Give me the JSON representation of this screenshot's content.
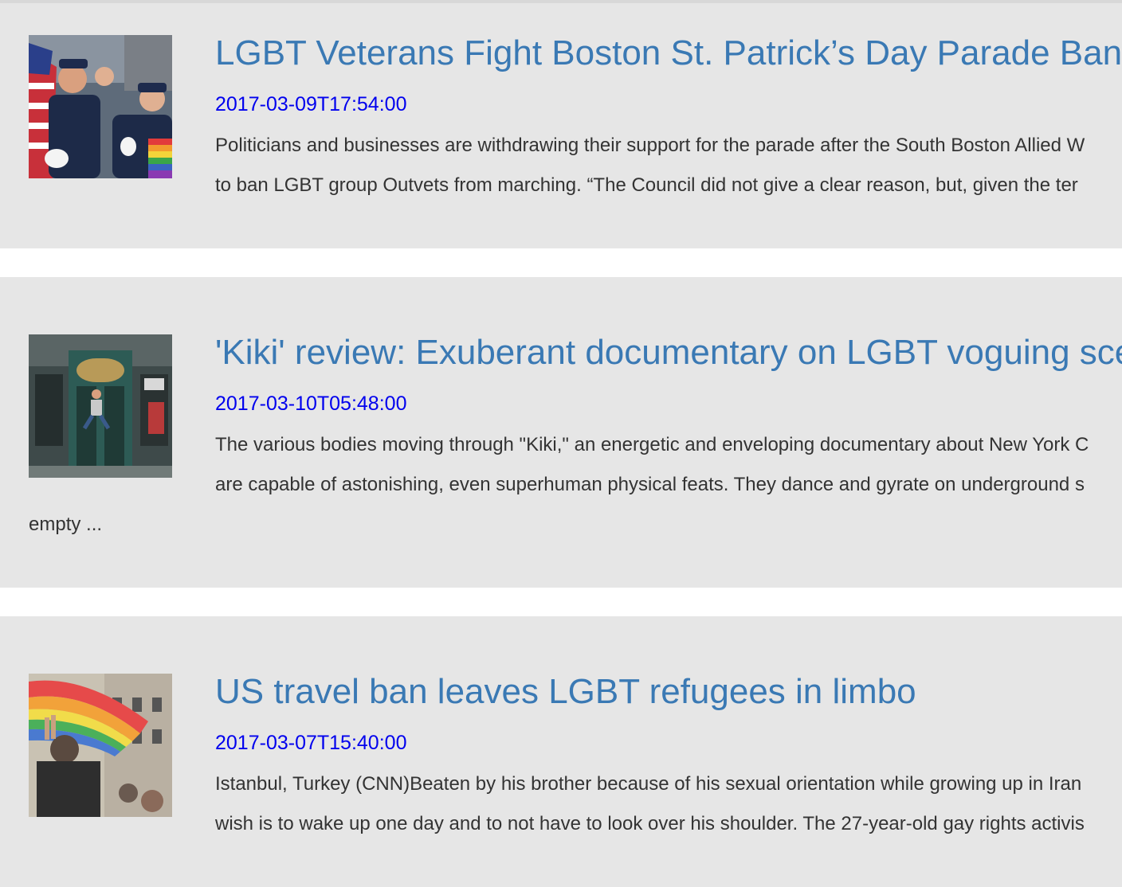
{
  "articles": [
    {
      "title": "LGBT Veterans Fight Boston St. Patrick’s Day Parade Ban",
      "date": "2017-03-09T17:54:00",
      "snippet_lines": [
        "Politicians and businesses are withdrawing their support for the parade after the South Boston Allied W",
        "to ban LGBT group Outvets from marching. “The Council did not give a clear reason, but, given the ter"
      ],
      "thumbnail": "veterans-parade-photo"
    },
    {
      "title": "'Kiki' review: Exuberant documentary on LGBT voguing scen",
      "date": "2017-03-10T05:48:00",
      "snippet_lines": [
        "The various bodies moving through \"Kiki,\" an energetic and enveloping documentary about New York C",
        "are capable of astonishing, even superhuman physical feats. They dance and gyrate on underground s",
        "empty ..."
      ],
      "thumbnail": "storefront-jump-photo"
    },
    {
      "title": "US travel ban leaves LGBT refugees in limbo",
      "date": "2017-03-07T15:40:00",
      "snippet_lines": [
        "Istanbul, Turkey (CNN)Beaten by his brother because of his sexual orientation while growing up in Iran",
        "wish is to wake up one day and to not have to look over his shoulder. The 27-year-old gay rights activis"
      ],
      "thumbnail": "rainbow-flag-street-photo"
    }
  ]
}
